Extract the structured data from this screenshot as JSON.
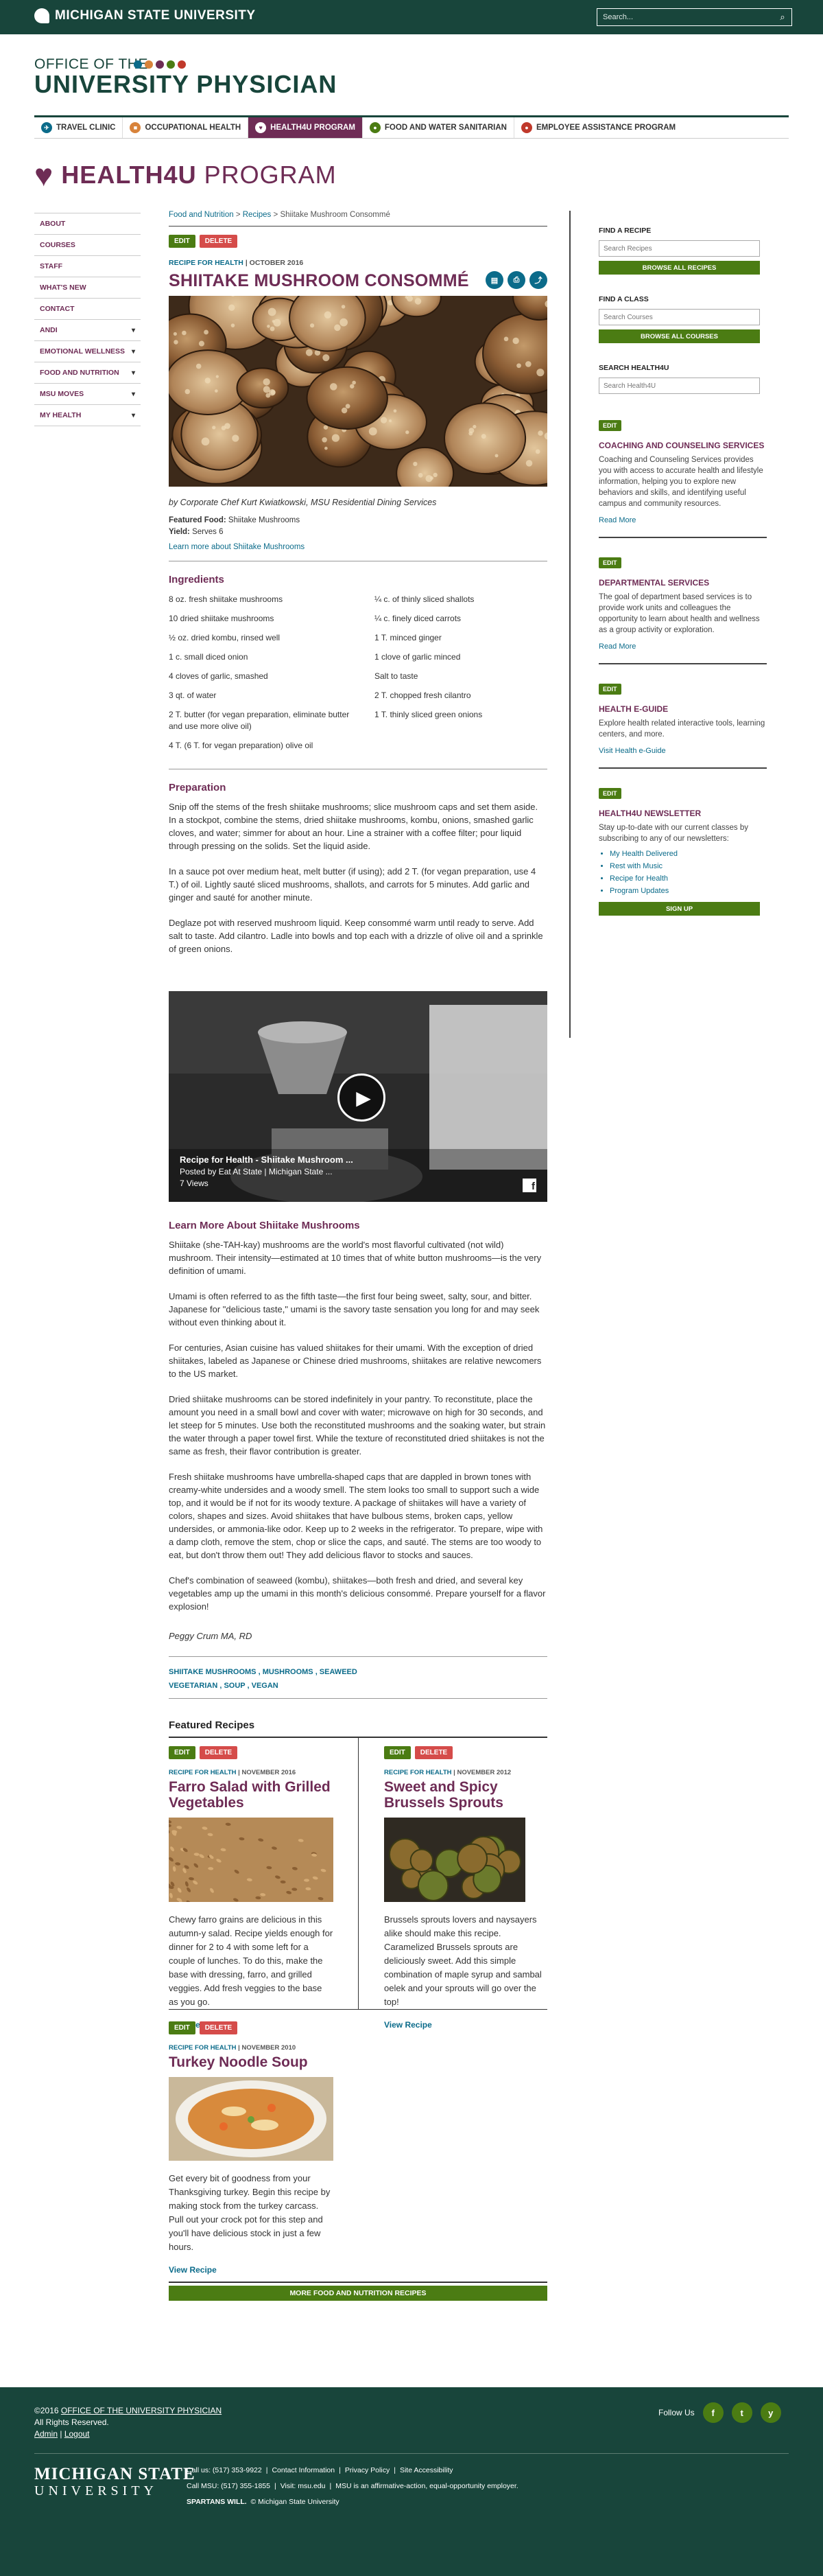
{
  "topbar": {
    "brand": "MICHIGAN STATE UNIVERSITY",
    "search_placeholder": "Search..."
  },
  "header": {
    "office_of": "OFFICE OF THE",
    "title": "UNIVERSITY PHYSICIAN"
  },
  "nav": [
    {
      "label": "TRAVEL CLINIC",
      "color": "#0b6b8a"
    },
    {
      "label": "OCCUPATIONAL HEALTH",
      "color": "#d8833b"
    },
    {
      "label": "HEALTH4U PROGRAM",
      "color": "#6e2c55"
    },
    {
      "label": "FOOD AND WATER SANITARIAN",
      "color": "#4b7c13"
    },
    {
      "label": "EMPLOYEE ASSISTANCE PROGRAM",
      "color": "#c0392b"
    }
  ],
  "program": {
    "title_bold": "HEALTH4U",
    "title_rest": " PROGRAM"
  },
  "leftnav": [
    {
      "label": "ABOUT",
      "chevron": false
    },
    {
      "label": "COURSES",
      "chevron": false
    },
    {
      "label": "STAFF",
      "chevron": false
    },
    {
      "label": "WHAT'S NEW",
      "chevron": false
    },
    {
      "label": "CONTACT",
      "chevron": false
    },
    {
      "label": "ANDI",
      "chevron": true
    },
    {
      "label": "EMOTIONAL WELLNESS",
      "chevron": true
    },
    {
      "label": "FOOD AND NUTRITION",
      "chevron": true
    },
    {
      "label": "MSU MOVES",
      "chevron": true
    },
    {
      "label": "MY HEALTH",
      "chevron": true
    }
  ],
  "breadcrumb": {
    "items": [
      "Food and Nutrition",
      "Recipes",
      "Shiitake Mushroom Consommé"
    ],
    "sep": ">"
  },
  "actions": {
    "edit": "EDIT",
    "delete": "DELETE"
  },
  "recipe": {
    "kicker": "RECIPE FOR HEALTH",
    "date": "| OCTOBER 2016",
    "title": "SHIITAKE MUSHROOM CONSOMMÉ",
    "byline": "by Corporate Chef Kurt Kwiatkowski, MSU Residential Dining Services",
    "featured_food_label": "Featured Food:",
    "featured_food": "Shiitake Mushrooms",
    "yield_label": "Yield:",
    "yield": "Serves 6",
    "learn_link": "Learn more about Shiitake Mushrooms",
    "ingredients_heading": "Ingredients",
    "ingredients_left": [
      "8 oz. fresh shiitake mushrooms",
      "10 dried shiitake mushrooms",
      "½ oz. dried kombu, rinsed well",
      "1 c. small diced onion",
      "4 cloves of garlic, smashed",
      "3 qt. of water",
      "2 T. butter (for vegan preparation, eliminate butter and use more olive oil)",
      "4 T. (6 T. for vegan preparation) olive oil"
    ],
    "ingredients_right": [
      "¼ c. of thinly sliced shallots",
      "¼ c. finely diced carrots",
      "1 T. minced ginger",
      "1 clove of garlic minced",
      "Salt to taste",
      "2 T. chopped fresh cilantro",
      "1 T. thinly sliced green onions"
    ],
    "prep_heading": "Preparation",
    "prep": [
      "Snip off the stems of the fresh shiitake mushrooms; slice mushroom caps and set them aside. In a stockpot, combine the stems, dried shiitake mushrooms, kombu, onions, smashed garlic cloves, and water; simmer for about an hour. Line a strainer with a coffee filter; pour liquid through pressing on the solids. Set the liquid aside.",
      "In a sauce pot over medium heat, melt butter (if using); add 2 T. (for vegan preparation, use 4 T.) of oil. Lightly sauté sliced mushrooms, shallots, and carrots for 5 minutes. Add garlic and ginger and sauté for another minute.",
      "Deglaze pot with reserved mushroom liquid. Keep consommé warm until ready to serve. Add salt to taste. Add cilantro. Ladle into bowls and top each with a drizzle of olive oil and a sprinkle of green onions."
    ],
    "video": {
      "title": "Recipe for Health - Shiitake Mushroom ...",
      "posted": "Posted by Eat At State | Michigan State ...",
      "views": "7 Views"
    },
    "learn_heading": "Learn More About Shiitake Mushrooms",
    "learn": [
      "Shiitake (she-TAH-kay) mushrooms are the world's most flavorful cultivated (not wild) mushroom. Their intensity—estimated at 10 times that of white button mushrooms—is the very definition of umami.",
      "Umami is often referred to as the fifth taste—the first four being sweet, salty, sour, and bitter. Japanese for \"delicious taste,\" umami is the savory taste sensation you long for and may seek without even thinking about it.",
      "For centuries, Asian cuisine has valued shiitakes for their umami. With the exception of dried shiitakes, labeled as Japanese or Chinese dried mushrooms, shiitakes are relative newcomers to the US market.",
      "Dried shiitake mushrooms can be stored indefinitely in your pantry. To reconstitute, place the amount you need in a small bowl and cover with water; microwave on high for 30 seconds, and let steep for 5 minutes. Use both the reconstituted mushrooms and the soaking water, but strain the water through a paper towel first. While the texture of reconstituted dried shiitakes is not the same as fresh, their flavor contribution is greater.",
      "Fresh shiitake mushrooms have umbrella-shaped caps that are dappled in brown tones with creamy-white undersides and a woody smell. The stem looks too small to support such a wide top, and it would be if not for its woody texture. A package of shiitakes will have a variety of colors, shapes and sizes. Avoid shiitakes that have bulbous stems, broken caps, yellow undersides, or ammonia-like odor. Keep up to 2 weeks in the refrigerator. To prepare, wipe with a damp cloth, remove the stem, chop or slice the caps, and sauté. The stems are too woody to eat, but don't throw them out! They add delicious flavor to stocks and sauces.",
      "Chef's combination of seaweed (kombu), shiitakes—both fresh and dried, and several key vegetables amp up the umami in this month's delicious consommé. Prepare yourself for a flavor explosion!"
    ],
    "author": "Peggy Crum MA, RD",
    "tags_line1": "SHIITAKE MUSHROOMS , MUSHROOMS , SEAWEED",
    "tags_line2": "VEGETARIAN , SOUP , VEGAN"
  },
  "featured": {
    "heading": "Featured Recipes",
    "cards": [
      {
        "kicker": "RECIPE FOR HEALTH",
        "date": "| NOVEMBER 2016",
        "title": "Farro Salad with Grilled Vegetables",
        "body": "Chewy farro grains are delicious in this autumn-y salad. Recipe yields enough for dinner for 2 to 4 with some left for a couple of lunches. To do this, make the base with dressing, farro, and grilled veggies. Add fresh veggies to the base as you go.",
        "link": "View Recipe"
      },
      {
        "kicker": "RECIPE FOR HEALTH",
        "date": "| NOVEMBER 2012",
        "title": "Sweet and Spicy Brussels Sprouts",
        "body": "Brussels sprouts lovers and naysayers alike should make this recipe. Caramelized Brussels sprouts are deliciously sweet. Add this simple combination of maple syrup and sambal oelek and your sprouts will go over the top!",
        "link": "View Recipe"
      },
      {
        "kicker": "RECIPE FOR HEALTH",
        "date": "| NOVEMBER 2010",
        "title": "Turkey Noodle Soup",
        "body": "Get every bit of goodness from your Thanksgiving turkey. Begin this recipe by making stock from the turkey carcass. Pull out your crock pot for this step and you'll have delicious stock in just a few hours.",
        "link": "View Recipe"
      }
    ],
    "more_button": "MORE FOOD AND NUTRITION RECIPES"
  },
  "right": {
    "find_recipe": {
      "heading": "FIND A RECIPE",
      "placeholder": "Search Recipes",
      "button": "BROWSE ALL RECIPES"
    },
    "find_class": {
      "heading": "FIND A CLASS",
      "placeholder": "Search Courses",
      "button": "BROWSE ALL COURSES"
    },
    "search_h4u": {
      "heading": "SEARCH HEALTH4U",
      "placeholder": "Search Health4U"
    },
    "blocks": [
      {
        "title": "COACHING AND COUNSELING SERVICES",
        "body": "Coaching and Counseling Services provides you with access to accurate health and lifestyle information, helping you to explore new behaviors and skills, and identifying useful campus and community resources.",
        "link": "Read More"
      },
      {
        "title": "DEPARTMENTAL SERVICES",
        "body": "The goal of department based services is to provide work units and colleagues the opportunity to learn about health and wellness as a group activity or exploration.",
        "link": "Read More"
      },
      {
        "title": "HEALTH E-GUIDE",
        "body": "Explore health related interactive tools, learning centers, and more.",
        "link": "Visit Health e-Guide"
      }
    ],
    "newsletter": {
      "title": "HEALTH4U NEWSLETTER",
      "body": "Stay up-to-date with our current classes by subscribing to any of our newsletters:",
      "items": [
        "My Health Delivered",
        "Rest with Music",
        "Recipe for Health",
        "Program Updates"
      ],
      "button": "SIGN UP"
    }
  },
  "footer": {
    "copyright": "©2016",
    "office_link": "OFFICE OF THE UNIVERSITY PHYSICIAN",
    "rights": "All Rights Reserved.",
    "admin": "Admin",
    "logout": "Logout",
    "follow": "Follow Us",
    "social": [
      "f",
      "t",
      "y"
    ],
    "msu_line1": "MICHIGAN STATE",
    "msu_line2": "UNIVERSITY",
    "links1": [
      "Call us: (517) 353-9922",
      "Contact Information",
      "Privacy Policy",
      "Site Accessibility"
    ],
    "links2": [
      "Call MSU: (517) 355-1855",
      "Visit: msu.edu",
      "MSU is an affirmative-action, equal-opportunity employer."
    ],
    "spartans": "SPARTANS WILL.",
    "msu_copy": "© Michigan State University"
  }
}
